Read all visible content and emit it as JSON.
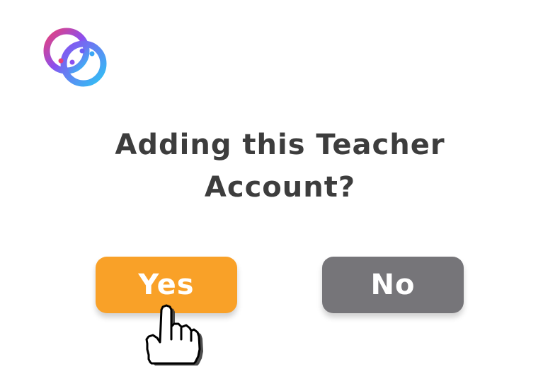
{
  "dialog": {
    "question": "Adding this Teacher Account?"
  },
  "buttons": {
    "yes_label": "Yes",
    "no_label": "No"
  },
  "icons": {
    "logo": "app-logo-icon",
    "cursor": "hand-pointer-icon"
  },
  "colors": {
    "yes_button": "#f9a128",
    "no_button": "#767579",
    "question_text": "#3d3d3d",
    "logo_gradient_start": "#e8407a",
    "logo_gradient_mid": "#8a4ff0",
    "logo_gradient_end": "#2fc3f5"
  }
}
